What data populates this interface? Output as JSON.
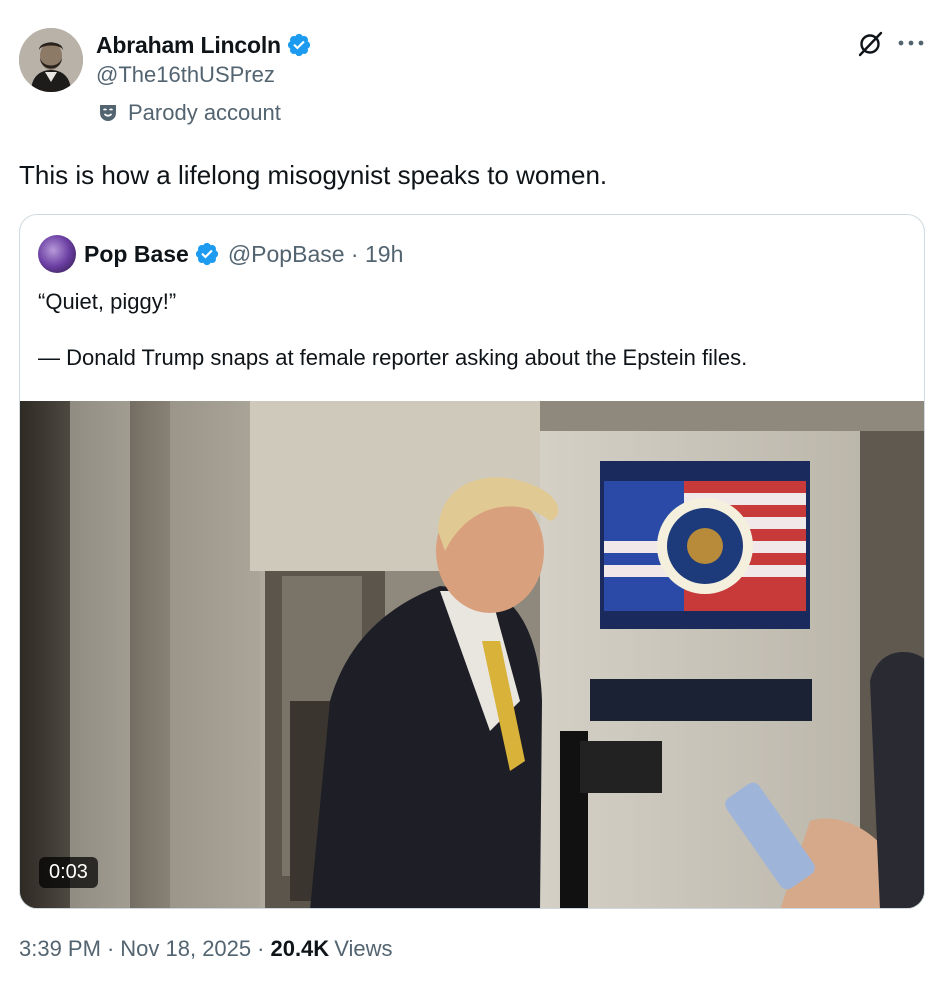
{
  "author": {
    "display_name": "Abraham Lincoln",
    "handle": "@The16thUSPrez",
    "label": "Parody account",
    "avatar_icon": "portrait-avatar",
    "verified_icon": "verified-badge-icon"
  },
  "tweet": {
    "text": "This is how a lifelong misogynist speaks to women.",
    "time": "3:39 PM",
    "date": "Nov 18, 2025",
    "views_count": "20.4K",
    "views_label": "Views"
  },
  "quoted": {
    "display_name": "Pop Base",
    "handle": "@PopBase",
    "age": "19h",
    "text_line1": "“Quiet, piggy!”",
    "text_line2": "— Donald Trump snaps at female reporter asking about the Epstein files.",
    "video_duration": "0:03"
  },
  "colors": {
    "verified": "#1d9bf0",
    "secondary_text": "#536471",
    "primary_text": "#0f1419",
    "border": "#cfd9de"
  }
}
